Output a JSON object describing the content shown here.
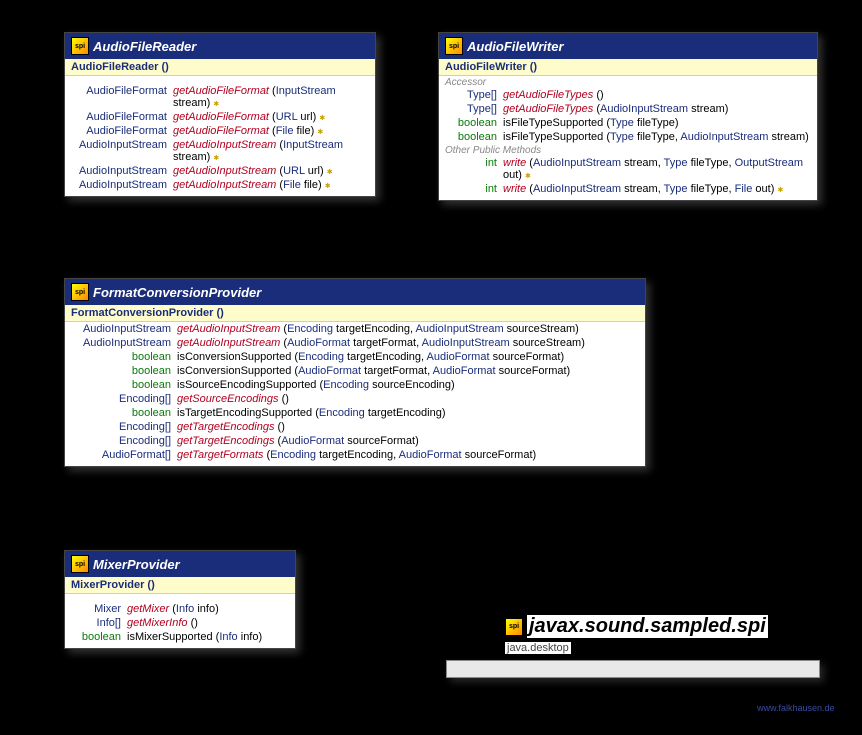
{
  "package": {
    "name": "javax.sound.sampled.spi",
    "module": "java.desktop",
    "icon_label": "spi"
  },
  "credit": "www.falkhausen.de",
  "classes": {
    "afr": {
      "title": "AudioFileReader",
      "constructor": "AudioFileReader ()",
      "methods": [
        {
          "ret": "AudioFileFormat",
          "name": "getAudioFileFormat",
          "params": [
            [
              "InputStream",
              "stream"
            ]
          ],
          "throws": true
        },
        {
          "ret": "AudioFileFormat",
          "name": "getAudioFileFormat",
          "params": [
            [
              "URL",
              "url"
            ]
          ],
          "throws": true
        },
        {
          "ret": "AudioFileFormat",
          "name": "getAudioFileFormat",
          "params": [
            [
              "File",
              "file"
            ]
          ],
          "throws": true
        },
        {
          "ret": "AudioInputStream",
          "name": "getAudioInputStream",
          "params": [
            [
              "InputStream",
              "stream"
            ]
          ],
          "throws": true
        },
        {
          "ret": "AudioInputStream",
          "name": "getAudioInputStream",
          "params": [
            [
              "URL",
              "url"
            ]
          ],
          "throws": true
        },
        {
          "ret": "AudioInputStream",
          "name": "getAudioInputStream",
          "params": [
            [
              "File",
              "file"
            ]
          ],
          "throws": true
        }
      ]
    },
    "afw": {
      "title": "AudioFileWriter",
      "constructor": "AudioFileWriter ()",
      "section1": "Accessor",
      "accessors": [
        {
          "ret": "Type[]",
          "name": "getAudioFileTypes",
          "params": []
        },
        {
          "ret": "Type[]",
          "name": "getAudioFileTypes",
          "params": [
            [
              "AudioInputStream",
              "stream"
            ]
          ]
        },
        {
          "ret": "boolean",
          "retGreen": true,
          "plain": true,
          "name": "isFileTypeSupported",
          "params": [
            [
              "Type",
              "fileType"
            ]
          ]
        },
        {
          "ret": "boolean",
          "retGreen": true,
          "plain": true,
          "name": "isFileTypeSupported",
          "params": [
            [
              "Type",
              "fileType"
            ],
            [
              "AudioInputStream",
              "stream"
            ]
          ]
        }
      ],
      "section2": "Other Public Methods",
      "others": [
        {
          "ret": "int",
          "retGreen": true,
          "name": "write",
          "params": [
            [
              "AudioInputStream",
              "stream"
            ],
            [
              "Type",
              "fileType"
            ],
            [
              "OutputStream",
              "out"
            ]
          ],
          "throws": true
        },
        {
          "ret": "int",
          "retGreen": true,
          "name": "write",
          "params": [
            [
              "AudioInputStream",
              "stream"
            ],
            [
              "Type",
              "fileType"
            ],
            [
              "File",
              "out"
            ]
          ],
          "throws": true
        }
      ]
    },
    "fcp": {
      "title": "FormatConversionProvider",
      "constructor": "FormatConversionProvider ()",
      "methods": [
        {
          "ret": "AudioInputStream",
          "name": "getAudioInputStream",
          "params": [
            [
              "Encoding",
              "targetEncoding"
            ],
            [
              "AudioInputStream",
              "sourceStream"
            ]
          ]
        },
        {
          "ret": "AudioInputStream",
          "name": "getAudioInputStream",
          "params": [
            [
              "AudioFormat",
              "targetFormat"
            ],
            [
              "AudioInputStream",
              "sourceStream"
            ]
          ]
        },
        {
          "ret": "boolean",
          "retGreen": true,
          "plain": true,
          "name": "isConversionSupported",
          "params": [
            [
              "Encoding",
              "targetEncoding"
            ],
            [
              "AudioFormat",
              "sourceFormat"
            ]
          ]
        },
        {
          "ret": "boolean",
          "retGreen": true,
          "plain": true,
          "name": "isConversionSupported",
          "params": [
            [
              "AudioFormat",
              "targetFormat"
            ],
            [
              "AudioFormat",
              "sourceFormat"
            ]
          ]
        },
        {
          "ret": "boolean",
          "retGreen": true,
          "plain": true,
          "name": "isSourceEncodingSupported",
          "params": [
            [
              "Encoding",
              "sourceEncoding"
            ]
          ]
        },
        {
          "ret": "Encoding[]",
          "name": "getSourceEncodings",
          "params": []
        },
        {
          "ret": "boolean",
          "retGreen": true,
          "plain": true,
          "name": "isTargetEncodingSupported",
          "params": [
            [
              "Encoding",
              "targetEncoding"
            ]
          ]
        },
        {
          "ret": "Encoding[]",
          "name": "getTargetEncodings",
          "params": []
        },
        {
          "ret": "Encoding[]",
          "name": "getTargetEncodings",
          "params": [
            [
              "AudioFormat",
              "sourceFormat"
            ]
          ]
        },
        {
          "ret": "AudioFormat[]",
          "name": "getTargetFormats",
          "params": [
            [
              "Encoding",
              "targetEncoding"
            ],
            [
              "AudioFormat",
              "sourceFormat"
            ]
          ]
        }
      ]
    },
    "mp": {
      "title": "MixerProvider",
      "constructor": "MixerProvider ()",
      "methods": [
        {
          "ret": "Mixer",
          "name": "getMixer",
          "params": [
            [
              "Info",
              "info"
            ]
          ]
        },
        {
          "ret": "Info[]",
          "name": "getMixerInfo",
          "params": []
        },
        {
          "ret": "boolean",
          "retGreen": true,
          "plain": true,
          "name": "isMixerSupported",
          "params": [
            [
              "Info",
              "info"
            ]
          ]
        }
      ]
    }
  }
}
